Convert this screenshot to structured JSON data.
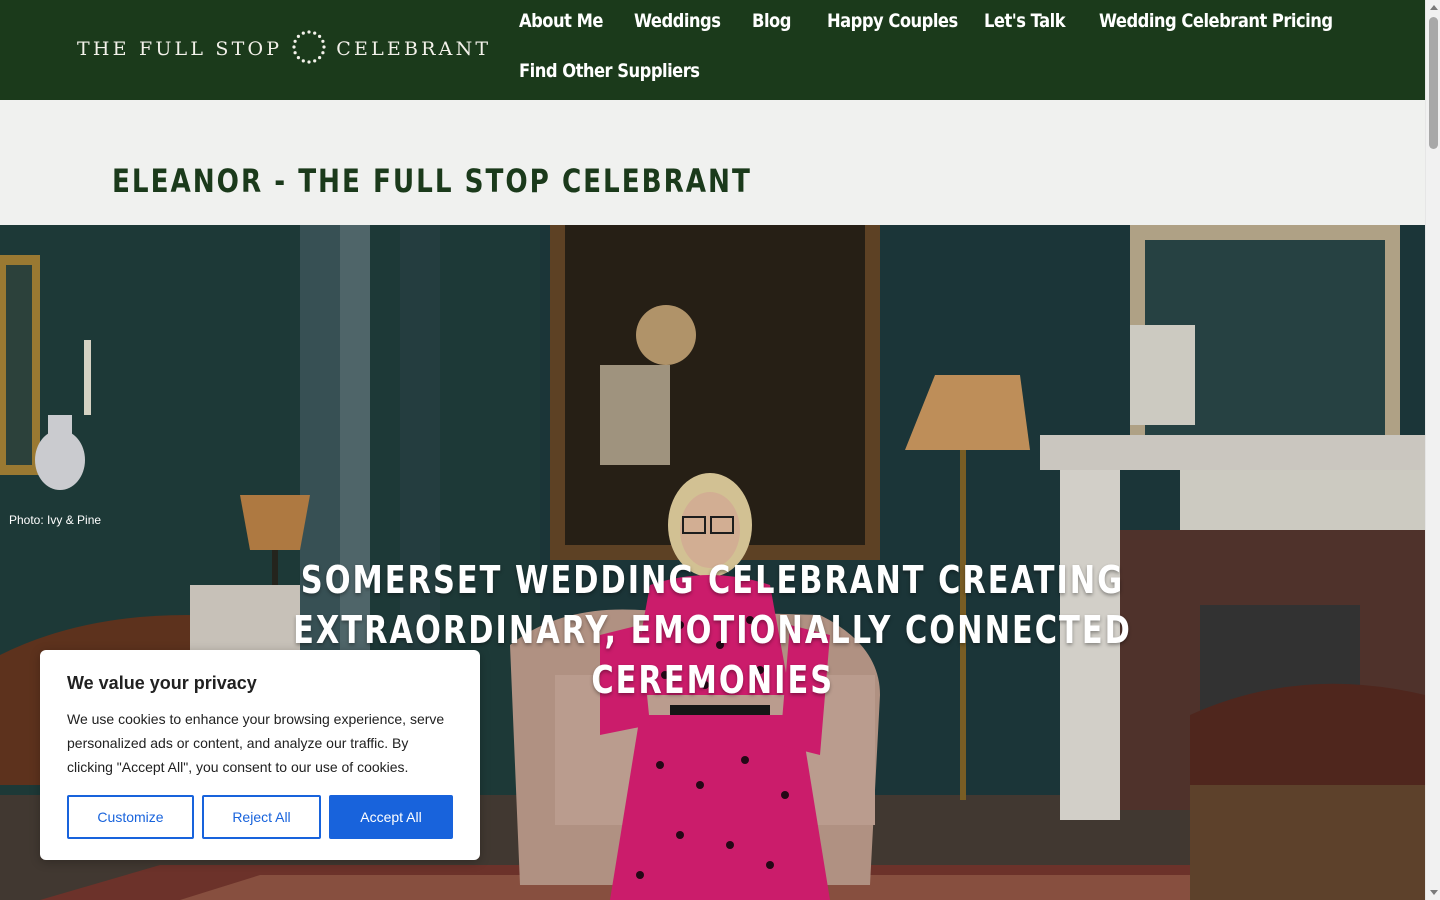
{
  "brand": {
    "logo_left": "THE FULL STOP",
    "logo_right": "CELEBRANT"
  },
  "nav": {
    "items": [
      {
        "label": "About Me"
      },
      {
        "label": "Weddings"
      },
      {
        "label": "Blog"
      },
      {
        "label": "Happy Couples"
      },
      {
        "label": "Let's Talk"
      },
      {
        "label": "Wedding Celebrant Pricing"
      },
      {
        "label": "Find Other Suppliers"
      }
    ]
  },
  "page": {
    "title": "ELEANOR - THE FULL STOP CELEBRANT"
  },
  "hero": {
    "photo_credit": "Photo: Ivy & Pine",
    "heading_line1": "SOMERSET WEDDING CELEBRANT CREATING EXTRAORDINARY, EMOTIONALLY CONNECTED",
    "heading_line2": "CEREMONIES"
  },
  "cookie_banner": {
    "title": "We value your privacy",
    "body": "We use cookies to enhance your browsing experience, serve personalized ads or content, and analyze our traffic. By clicking \"Accept All\", you consent to our use of cookies.",
    "customize_label": "Customize",
    "reject_label": "Reject All",
    "accept_label": "Accept All"
  },
  "colors": {
    "header_bg": "#1b3a1b",
    "page_bg": "#f0f1ef",
    "accent_blue": "#1863dc",
    "dress_pink": "#e8207a"
  }
}
